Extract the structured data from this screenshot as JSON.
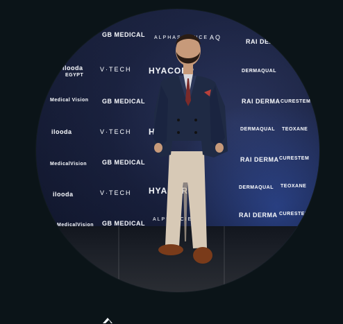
{
  "backdrop_logos": {
    "gb_medical_1": "GB MEDICAL",
    "alphascience_1": "ALPHASCIENCE",
    "aq_1": "AQ",
    "rai_derma_1": "RAI DERMA",
    "ilooda_1": "ilooda",
    "ilooda_egypt_1": "EGYPT",
    "vtech_1": "V·TECH",
    "hya_1": "HYACORP",
    "dermaqual_1": "DERMAQUAL",
    "medicalvision_1": "Medical Vision",
    "gb_medical_2": "GB MEDICAL",
    "curestem_1": "CURESTEM",
    "ilooda_2": "ilooda",
    "vtech_2": "V·TECH",
    "hya_2": "HYA",
    "dermaqual_2": "DERMAQUAL",
    "teoxane_1": "TEOXANE",
    "medicalvision_2": "MedicalVision",
    "gb_medical_3": "GB MEDICAL",
    "rai_derma_2": "RAI DERMA",
    "curestem_2": "CURESTEM",
    "ilooda_3": "ilooda",
    "vtech_3": "V·TECH",
    "hya_3": "HYACORP",
    "dermaqual_3": "DERMAQUAL",
    "teoxane_2": "TEOXANE",
    "medicalvision_3": "MedicalVision",
    "gb_medical_4": "GB MEDICAL",
    "alphascience_2": "ALPHASCIENCE",
    "rai_derma_3": "RAI DERMA",
    "curestem_3": "CURESTEM"
  },
  "colors": {
    "page_background": "#0b1418",
    "backdrop": "#18203f",
    "suit": "#1f2a44",
    "trousers": "#d7c9b6",
    "shoes": "#7a3b1a"
  }
}
